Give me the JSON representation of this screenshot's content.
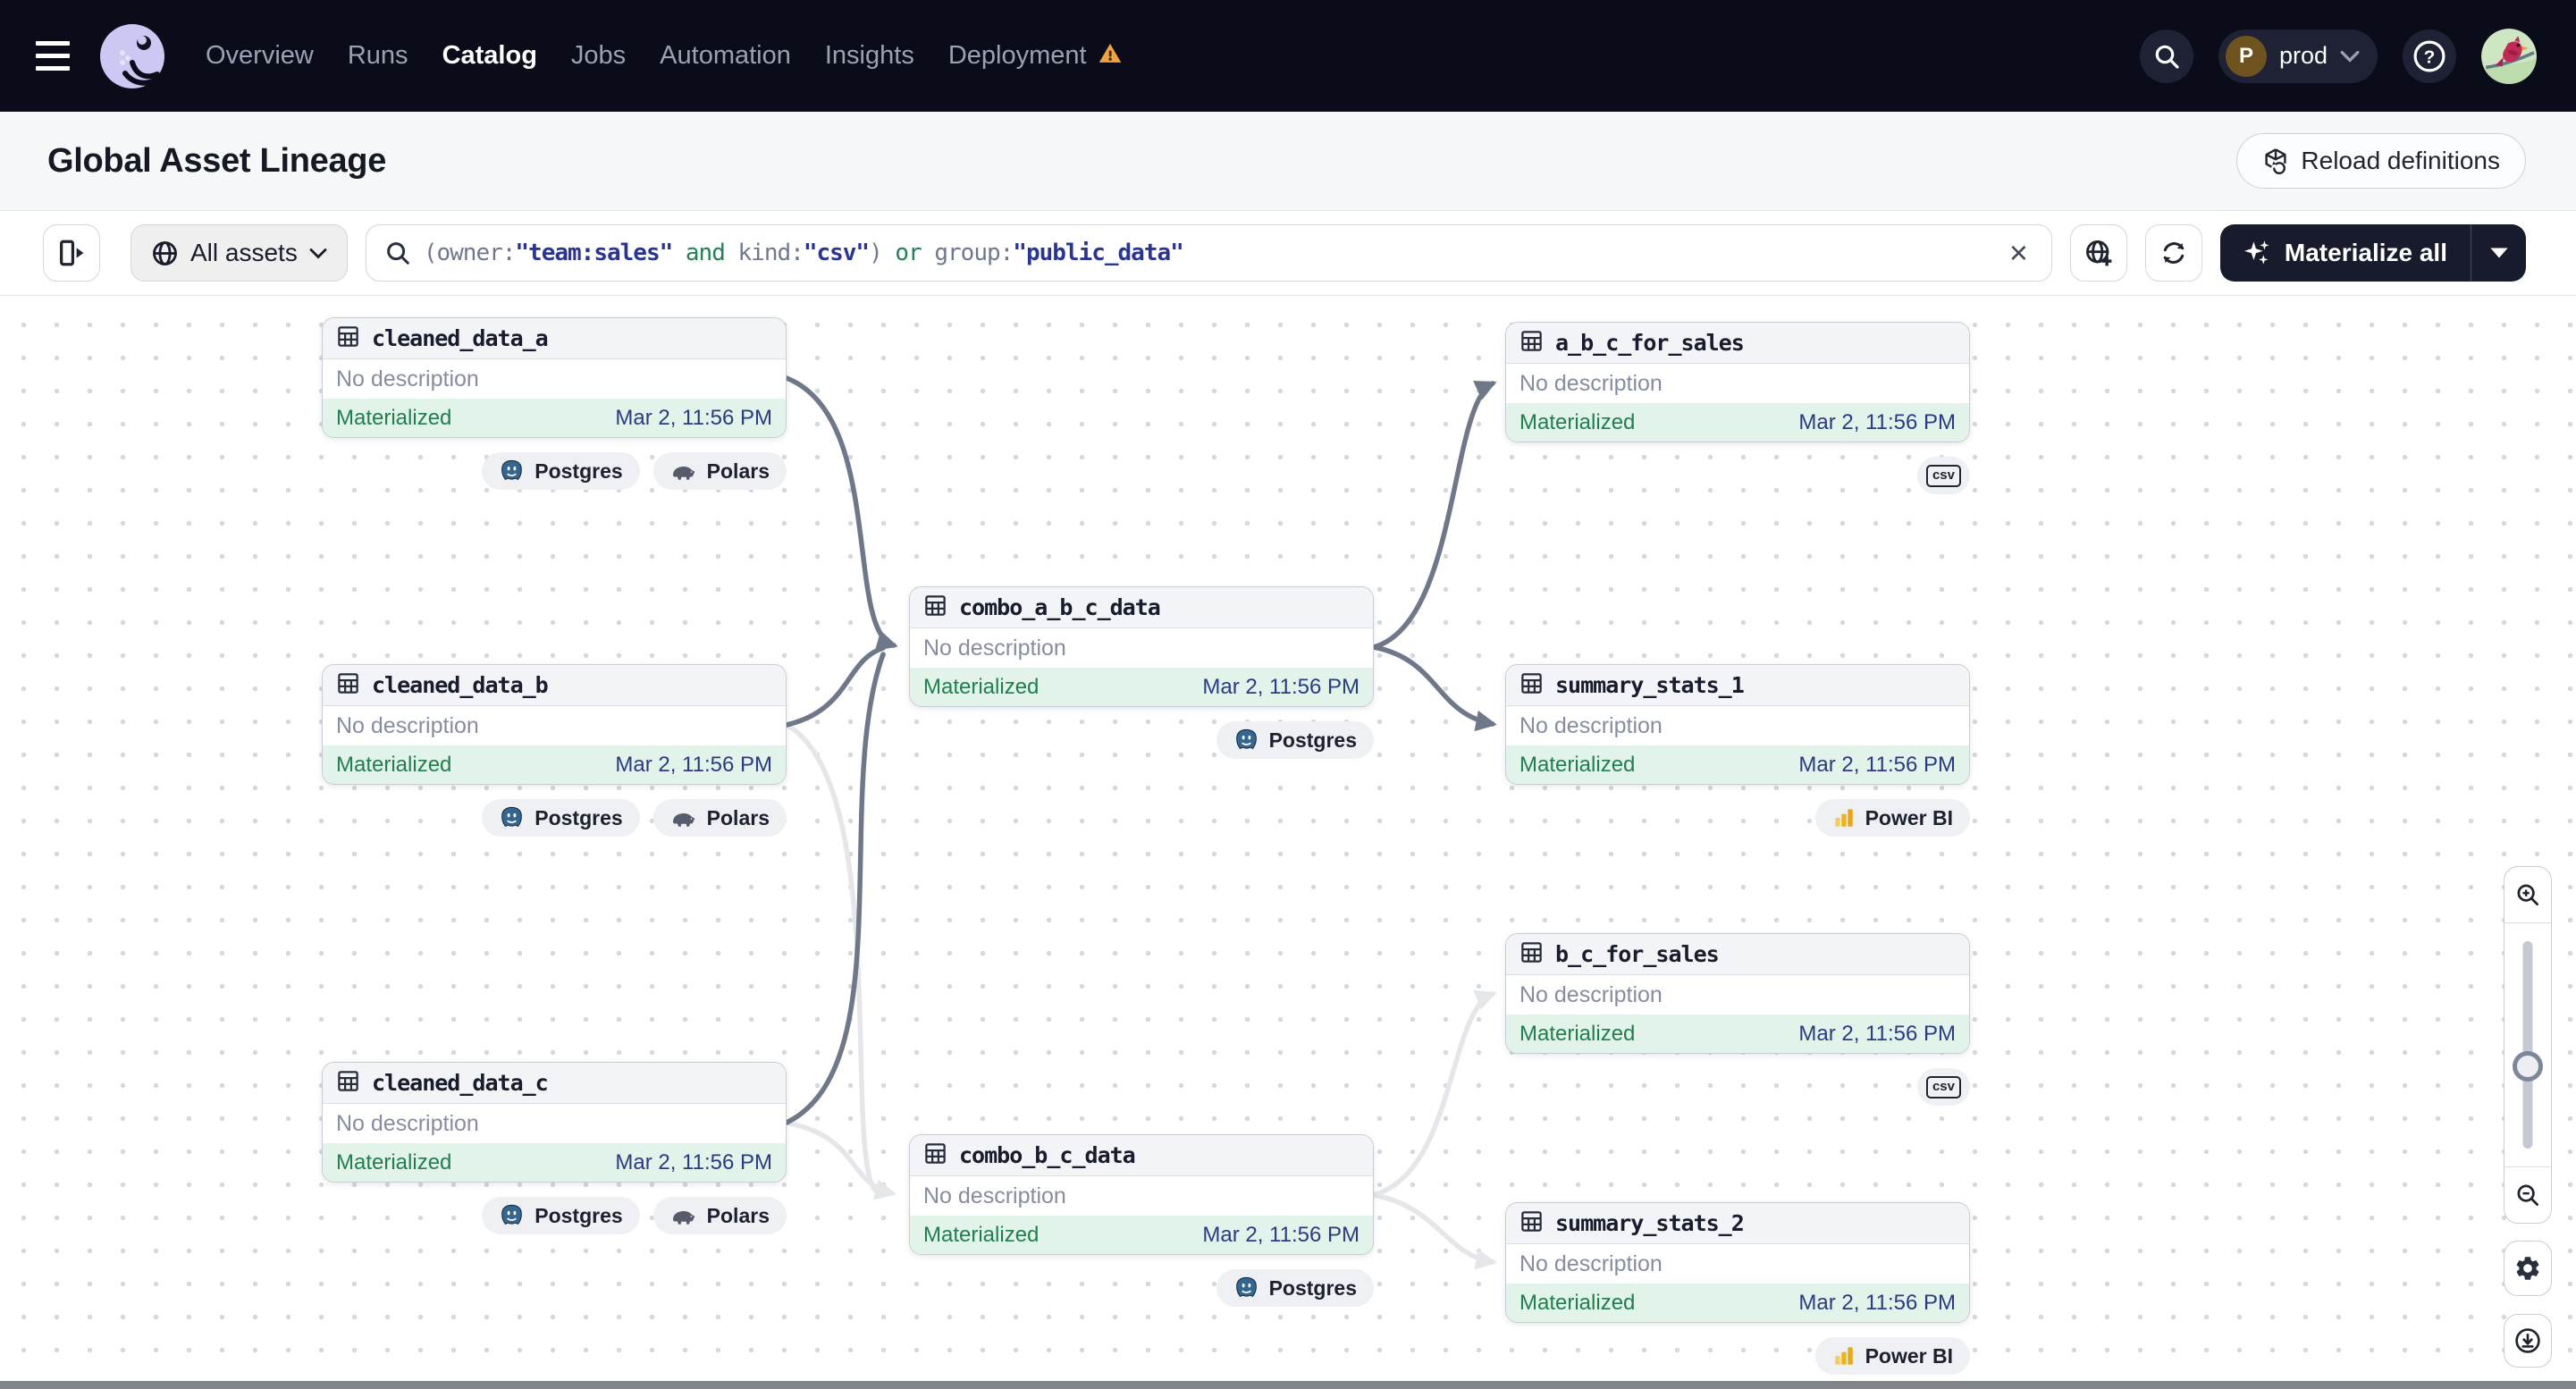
{
  "nav": {
    "items": [
      "Overview",
      "Runs",
      "Catalog",
      "Jobs",
      "Automation",
      "Insights",
      "Deployment"
    ],
    "active_item": "Catalog",
    "deployment_has_warning": true,
    "environment": {
      "initial": "P",
      "name": "prod"
    }
  },
  "header": {
    "title": "Global Asset Lineage",
    "reload_button_label": "Reload definitions"
  },
  "toolbar": {
    "asset_filter_label": "All assets",
    "search": {
      "query": "(owner:\"team:sales\" and kind:\"csv\") or group:\"public_data\"",
      "segments": [
        {
          "text": "(owner:",
          "type": "plain"
        },
        {
          "text": "\"team:sales\"",
          "type": "value"
        },
        {
          "text": " and ",
          "type": "operator"
        },
        {
          "text": "kind:",
          "type": "plain"
        },
        {
          "text": "\"csv\"",
          "type": "value"
        },
        {
          "text": ") ",
          "type": "plain"
        },
        {
          "text": "or",
          "type": "operator"
        },
        {
          "text": " group:",
          "type": "plain"
        },
        {
          "text": "\"public_data\"",
          "type": "value"
        }
      ]
    },
    "materialize_button_label": "Materialize all"
  },
  "graph": {
    "nodes": [
      {
        "name": "cleaned_data_a",
        "description": "No description",
        "status": "Materialized",
        "materialized_at": "Mar 2, 11:56 PM",
        "kinds": [
          "Postgres",
          "Polars"
        ]
      },
      {
        "name": "cleaned_data_b",
        "description": "No description",
        "status": "Materialized",
        "materialized_at": "Mar 2, 11:56 PM",
        "kinds": [
          "Postgres",
          "Polars"
        ]
      },
      {
        "name": "cleaned_data_c",
        "description": "No description",
        "status": "Materialized",
        "materialized_at": "Mar 2, 11:56 PM",
        "kinds": [
          "Postgres",
          "Polars"
        ]
      },
      {
        "name": "combo_a_b_c_data",
        "description": "No description",
        "status": "Materialized",
        "materialized_at": "Mar 2, 11:56 PM",
        "kinds": [
          "Postgres"
        ]
      },
      {
        "name": "combo_b_c_data",
        "description": "No description",
        "status": "Materialized",
        "materialized_at": "Mar 2, 11:56 PM",
        "kinds": [
          "Postgres"
        ]
      },
      {
        "name": "a_b_c_for_sales",
        "description": "No description",
        "status": "Materialized",
        "materialized_at": "Mar 2, 11:56 PM",
        "kinds": [
          "csv"
        ]
      },
      {
        "name": "summary_stats_1",
        "description": "No description",
        "status": "Materialized",
        "materialized_at": "Mar 2, 11:56 PM",
        "kinds": [
          "Power BI"
        ]
      },
      {
        "name": "b_c_for_sales",
        "description": "No description",
        "status": "Materialized",
        "materialized_at": "Mar 2, 11:56 PM",
        "kinds": [
          "csv"
        ]
      },
      {
        "name": "summary_stats_2",
        "description": "No description",
        "status": "Materialized",
        "materialized_at": "Mar 2, 11:56 PM",
        "kinds": [
          "Power BI"
        ]
      }
    ],
    "edges": [
      {
        "from": "cleaned_data_a",
        "to": "combo_a_b_c_data",
        "style": "highlighted"
      },
      {
        "from": "cleaned_data_b",
        "to": "combo_a_b_c_data",
        "style": "highlighted"
      },
      {
        "from": "cleaned_data_c",
        "to": "combo_a_b_c_data",
        "style": "highlighted"
      },
      {
        "from": "combo_a_b_c_data",
        "to": "a_b_c_for_sales",
        "style": "highlighted"
      },
      {
        "from": "combo_a_b_c_data",
        "to": "summary_stats_1",
        "style": "highlighted"
      },
      {
        "from": "cleaned_data_b",
        "to": "combo_b_c_data",
        "style": "muted"
      },
      {
        "from": "cleaned_data_c",
        "to": "combo_b_c_data",
        "style": "muted"
      },
      {
        "from": "combo_b_c_data",
        "to": "b_c_for_sales",
        "style": "muted"
      },
      {
        "from": "combo_b_c_data",
        "to": "summary_stats_2",
        "style": "muted"
      }
    ]
  },
  "zoom_controls": {
    "slider_position": 0.33
  },
  "colors": {
    "nav_bg": "#0a0d19",
    "accent_dark": "#171b2c",
    "materialized_green": "#1f7f4f",
    "materialized_bg": "#e2f3e9",
    "timestamp_navy": "#2b3a85",
    "edge_highlight": "#6e7889",
    "edge_muted": "#e4e6ea",
    "warning": "#f0a23f"
  }
}
